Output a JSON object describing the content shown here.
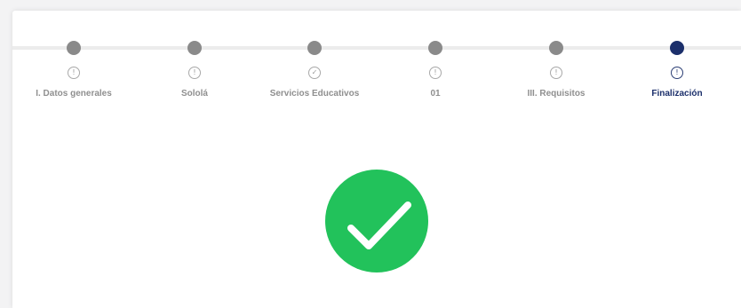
{
  "stepper": {
    "steps": [
      {
        "label": "I. Datos generales",
        "status": "info",
        "status_glyph": "!",
        "state": "completed"
      },
      {
        "label": "Sololá",
        "status": "info",
        "status_glyph": "!",
        "state": "completed"
      },
      {
        "label": "Servicios Educativos",
        "status": "check",
        "status_glyph": "✓",
        "state": "completed"
      },
      {
        "label": "01",
        "status": "info",
        "status_glyph": "!",
        "state": "completed"
      },
      {
        "label": "III. Requisitos",
        "status": "info",
        "status_glyph": "!",
        "state": "completed"
      },
      {
        "label": "Finalización",
        "status": "info",
        "status_glyph": "!",
        "state": "active"
      }
    ]
  },
  "colors": {
    "completed_dot": "#8a8a8a",
    "active_dot": "#1b2f6b",
    "success_circle": "#22c25b"
  },
  "success": {
    "icon": "checkmark-icon"
  }
}
